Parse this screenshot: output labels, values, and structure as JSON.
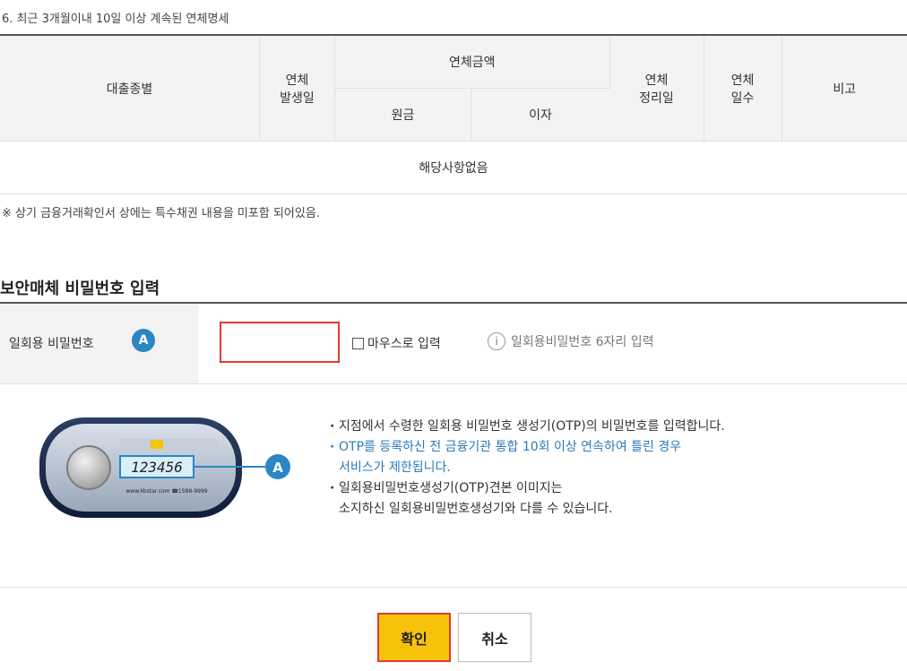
{
  "section6": {
    "title": "6. 최근 3개월이내 10일 이상 계속된 연체명세",
    "table": {
      "col_loan_type": "대출종별",
      "col_occur_date_1": "연체",
      "col_occur_date_2": "발생일",
      "col_amount_group": "연체금액",
      "col_principal": "원금",
      "col_interest": "이자",
      "col_settle_date_1": "연체",
      "col_settle_date_2": "정리일",
      "col_days_1": "연체",
      "col_days_2": "일수",
      "col_remarks": "비고",
      "empty_message": "해당사항없음"
    },
    "note": "※ 상기 금융거래확인서 상에는 특수채권 내용을 미포함 되어있음."
  },
  "security": {
    "heading": "보안매체 비밀번호 입력",
    "otp_label": "일회용 비밀번호",
    "badge": "A",
    "mouse_input_label": "마우스로 입력",
    "info_text": "일회용비밀번호 6자리 입력",
    "input_value": ""
  },
  "otp_device": {
    "display_value": "123456",
    "marker": "A",
    "footer": "www.kbstar.com ☎1588-9999"
  },
  "instructions": {
    "line1": "지점에서 수령한 일회용 비밀번호 생성기(OTP)의 비밀번호를 입력합니다.",
    "line2a": "OTP를 등록하신 전 금융기관 통합 10회 이상 연속하여 틀린 경우",
    "line2b": "서비스가 제한됩니다.",
    "line3a": "일회용비밀번호생성기(OTP)견본 이미지는",
    "line3b": "소지하신 일회용비밀번호생성기와 다를 수 있습니다."
  },
  "buttons": {
    "confirm": "확인",
    "cancel": "취소"
  },
  "colors": {
    "accent_yellow": "#f7c30a",
    "highlight_red": "#e53935",
    "info_blue": "#2b7bb9"
  }
}
